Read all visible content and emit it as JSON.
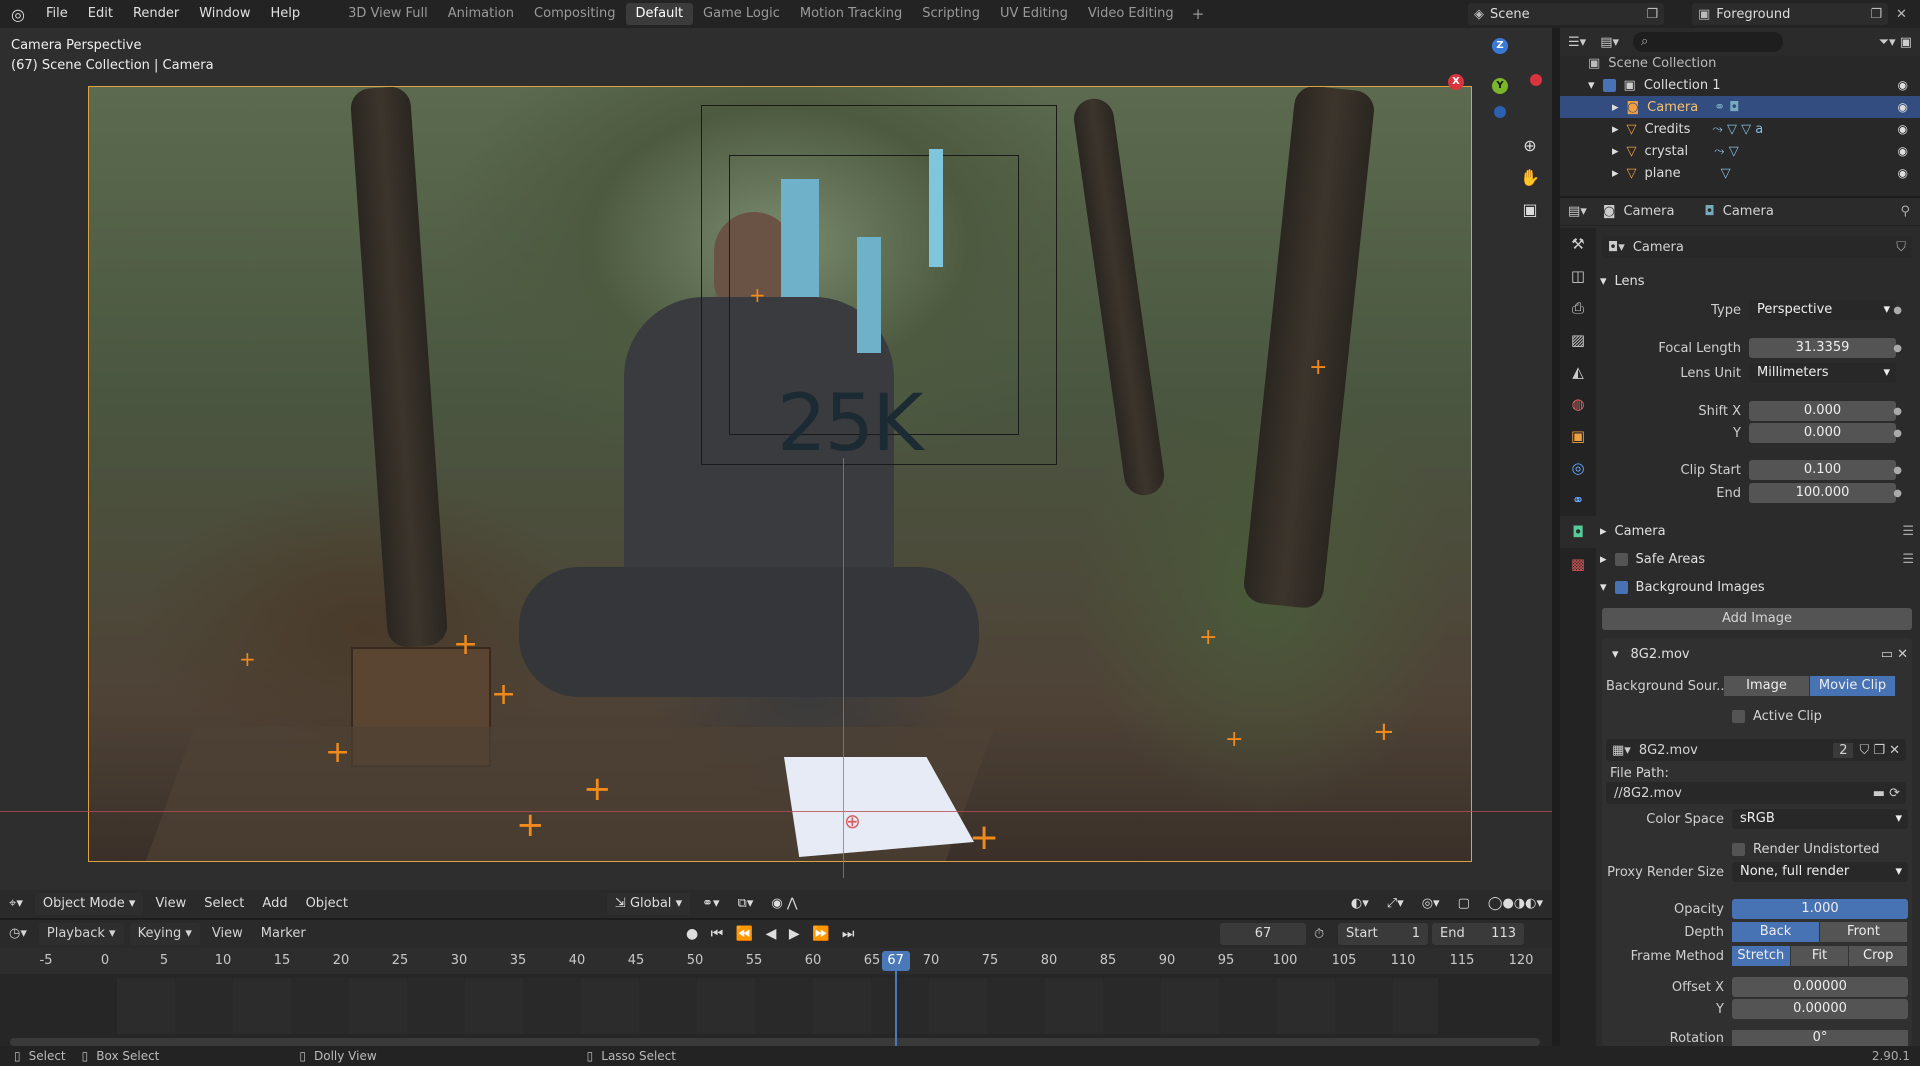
{
  "menu": {
    "items": [
      "File",
      "Edit",
      "Render",
      "Window",
      "Help"
    ]
  },
  "workspaces": [
    "3D View Full",
    "Animation",
    "Compositing",
    "Default",
    "Game Logic",
    "Motion Tracking",
    "Scripting",
    "UV Editing",
    "Video Editing"
  ],
  "active_workspace": "Default",
  "scene": "Scene",
  "view_layer": "Foreground",
  "viewport": {
    "title": "Camera Perspective",
    "subtitle": "(67) Scene Collection | Camera",
    "overlay_text": "25K"
  },
  "viewport_header": {
    "mode": "Object Mode",
    "menus": [
      "View",
      "Select",
      "Add",
      "Object"
    ],
    "orientation": "Global"
  },
  "timeline": {
    "menus": [
      "Playback",
      "Keying",
      "View",
      "Marker"
    ],
    "current_frame": "67",
    "start_label": "Start",
    "start": "1",
    "end_label": "End",
    "end": "113",
    "ticks": [
      "-5",
      "0",
      "5",
      "10",
      "15",
      "20",
      "25",
      "30",
      "35",
      "40",
      "45",
      "50",
      "55",
      "60",
      "65",
      "67",
      "70",
      "75",
      "80",
      "85",
      "90",
      "95",
      "100",
      "105",
      "110",
      "115",
      "120"
    ]
  },
  "status": {
    "select": "Select",
    "box_select": "Box Select",
    "dolly": "Dolly View",
    "lasso": "Lasso Select",
    "version": "2.90.1"
  },
  "outliner": {
    "root": "Scene Collection",
    "collection": "Collection 1",
    "objects": [
      "Camera",
      "Credits",
      "crystal",
      "plane"
    ]
  },
  "props": {
    "breadcrumb": [
      "Camera",
      "Camera"
    ],
    "datablock": "Camera",
    "lens_header": "Lens",
    "type_label": "Type",
    "type": "Perspective",
    "focal_label": "Focal Length",
    "focal": "31.3359",
    "unit_label": "Lens Unit",
    "unit": "Millimeters",
    "shiftx_label": "Shift X",
    "shiftx": "0.000",
    "shifty_label": "Y",
    "shifty": "0.000",
    "clipstart_label": "Clip Start",
    "clipstart": "0.100",
    "clipend_label": "End",
    "clipend": "100.000",
    "camera_header": "Camera",
    "safe_header": "Safe Areas",
    "bg_header": "Background Images",
    "add_image": "Add Image",
    "clip_name": "8G2.mov",
    "bgsrc_label": "Background Sour...",
    "bgsrc_opts": [
      "Image",
      "Movie Clip"
    ],
    "active_clip": "Active Clip",
    "clip_field": "8G2.mov",
    "clip_users": "2",
    "filepath_label": "File Path:",
    "filepath": "//8G2.mov",
    "colorspace_label": "Color Space",
    "colorspace": "sRGB",
    "render_undist": "Render Undistorted",
    "proxy_label": "Proxy Render Size",
    "proxy": "None, full render",
    "opacity_label": "Opacity",
    "opacity": "1.000",
    "depth_label": "Depth",
    "depth_opts": [
      "Back",
      "Front"
    ],
    "frame_label": "Frame Method",
    "frame_opts": [
      "Stretch",
      "Fit",
      "Crop"
    ],
    "offx_label": "Offset X",
    "offx": "0.00000",
    "offy_label": "Y",
    "offy": "0.00000",
    "rot_label": "Rotation",
    "rot": "0°"
  }
}
